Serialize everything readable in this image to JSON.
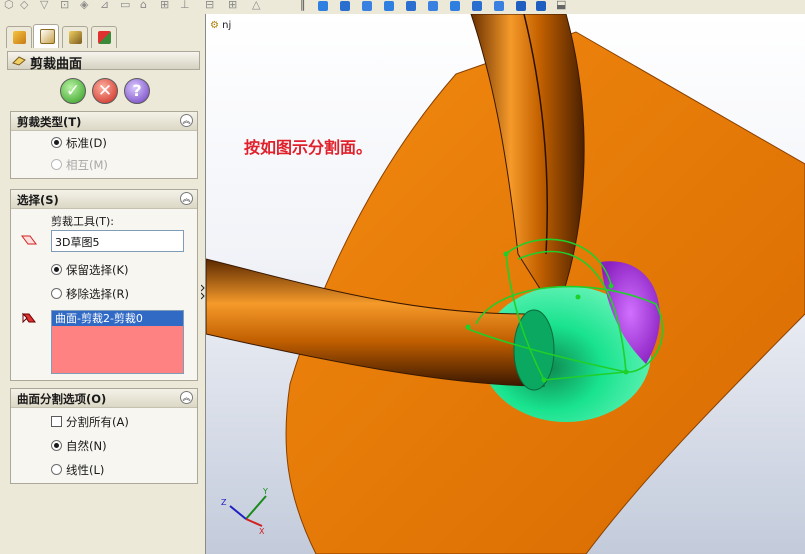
{
  "panel": {
    "title": "剪裁曲面",
    "tabs": [
      "feature-manager",
      "property-manager",
      "configuration-manager",
      "display-manager"
    ],
    "trim_type": {
      "header": "剪裁类型(T)",
      "options": [
        {
          "label": "标准(D)",
          "selected": true,
          "enabled": true
        },
        {
          "label": "相互(M)",
          "selected": false,
          "enabled": false
        }
      ]
    },
    "selection": {
      "header": "选择(S)",
      "trim_tool_label": "剪裁工具(T):",
      "trim_tool_value": "3D草图5",
      "keep_label": "保留选择(K)",
      "remove_label": "移除选择(R)",
      "keep_selected": true,
      "list_items": [
        "曲面-剪裁2-剪裁0"
      ]
    },
    "split_options": {
      "header": "曲面分割选项(O)",
      "split_all_label": "分割所有(A)",
      "split_all_checked": false,
      "natural_label": "自然(N)",
      "linear_label": "线性(L)",
      "natural_selected": true
    }
  },
  "viewport": {
    "part_name": "nj",
    "annotation": "按如图示分割面。",
    "triad": {
      "x": "X",
      "y": "Y",
      "z": "Z"
    }
  },
  "colors": {
    "surface_orange": "#e67300",
    "selected_green": "#19e38f",
    "selected_purple": "#b040e0",
    "annotation_red": "#e0202a",
    "list_pink": "#ff8282"
  }
}
